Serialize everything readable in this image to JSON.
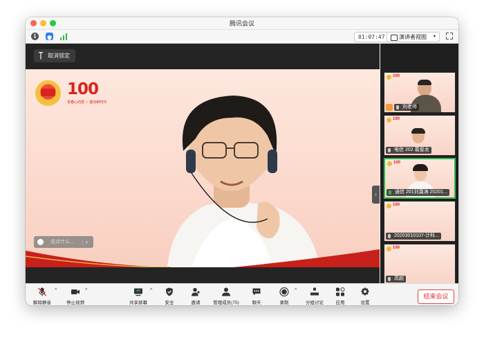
{
  "window": {
    "title": "腾讯会议"
  },
  "infobar": {
    "timer": "01:07:47",
    "view_label": "演讲者视图",
    "view_caret": "▾"
  },
  "stage": {
    "unlock_label": "取消锁定",
    "logo_hundred": "100",
    "logo_slogan": "青春心向党 ☆ 建功新时代",
    "comment_placeholder": "说点什么...",
    "comment_collapse": "‹",
    "gallery_toggle": "›"
  },
  "participants": [
    {
      "name": "刘老师",
      "host": true,
      "mic_active": false,
      "speaking": false
    },
    {
      "name": "电信 202 葛俊龙",
      "host": false,
      "mic_active": false,
      "speaking": false
    },
    {
      "name": "通信 201刘瀛涛 20201...",
      "host": false,
      "mic_active": true,
      "speaking": true
    },
    {
      "name": "20203010107-计科...",
      "host": false,
      "mic_active": false,
      "speaking": false
    },
    {
      "name": "高超",
      "host": false,
      "mic_active": false,
      "speaking": false
    }
  ],
  "toolbar": {
    "unmute": "解除静音",
    "stop_video": "停止视频",
    "share_screen": "共享屏幕",
    "security": "安全",
    "invite": "邀请",
    "manage_members": "管理成员(75)",
    "chat": "聊天",
    "record": "录制",
    "breakout": "分组讨论",
    "apps": "应用",
    "settings": "设置",
    "end_meeting": "结束会议",
    "caret": "^"
  },
  "colors": {
    "accent_green": "#2bbd4f",
    "end_red": "#e03030",
    "brand_red": "#d9231e"
  }
}
